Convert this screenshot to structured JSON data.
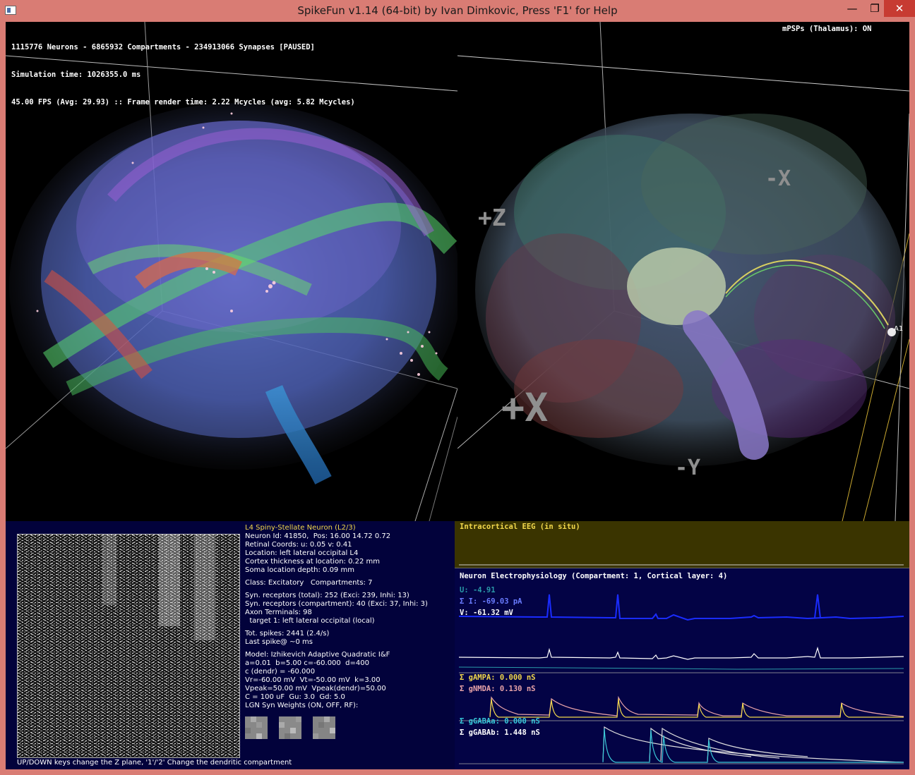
{
  "window": {
    "title": "SpikeFun v1.14 (64-bit) by Ivan Dimkovic, Press 'F1' for Help",
    "min_glyph": "—",
    "max_glyph": "❐",
    "close_glyph": "✕"
  },
  "hud": {
    "line1": "1115776 Neurons - 6865932 Compartments - 234913066 Synapses [PAUSED]",
    "line2": "Simulation time: 1026355.0 ms",
    "line3": "45.00 FPS (Avg: 29.93) :: Frame render time: 2.22 Mcycles (avg: 5.82 Mcycles)",
    "mpsps": "mPSPs (Thalamus): ON"
  },
  "axes": {
    "plus_z": "+Z",
    "minus_x": "-X",
    "plus_x": "+X",
    "minus_y": "-Y",
    "marker": "A1"
  },
  "neuron_info": {
    "title": "L4 Spiny-Stellate Neuron (L2/3)",
    "lines": [
      "Neuron Id: 41850,  Pos: 16.00 14.72 0.72",
      "Retinal Coords: u: 0.05 v: 0.41",
      "Location: left lateral occipital L4",
      "Cortex thickness at location: 0.22 mm",
      "Soma location depth: 0.09 mm",
      "",
      "Class: Excitatory   Compartments: 7",
      "",
      "Syn. receptors (total): 252 (Exci: 239, Inhi: 13)",
      "Syn. receptors (compartment): 40 (Exci: 37, Inhi: 3)",
      "Axon Terminals: 98",
      "  target 1: left lateral occipital (local)",
      "",
      "Tot. spikes: 2441 (2.4/s)",
      "Last spike@ ~0 ms",
      "",
      "Model: Izhikevich Adaptive Quadratic I&F",
      "a=0.01  b=5.00 c=-60.000  d=400",
      "c (dendr) = -60.000",
      "Vr=-60.00 mV  Vt=-50.00 mV  k=3.00",
      "Vpeak=50.00 mV  Vpeak(dendr)=50.00",
      "C = 100 uF  Gu: 3.0  Gd: 5.0",
      "LGN Syn Weights (ON, OFF, RF):"
    ],
    "footer": "UP/DOWN keys change the Z plane, '1'/'2' Change the dendritic compartment"
  },
  "eeg": {
    "title": "Intracortical EEG (in situ)"
  },
  "ephys": {
    "title": "Neuron Electrophysiology (Compartment: 1, Cortical layer: 4)",
    "u_label": "U: -4.91",
    "i_label": "Σ I: -69.03 pA",
    "v_label": "V: -61.32 mV",
    "gampa": "Σ gAMPA: 0.000 nS",
    "gnmda": "Σ gNMDA: 0.130 nS",
    "ggabaa": "Σ gGABAa: 0.000 nS",
    "ggabab": "Σ gGABAb: 1.448 nS"
  },
  "colors": {
    "u_label": "#2a9aa8",
    "i_label": "#6a7cff",
    "v_label": "#ffffff",
    "gampa": "#f2d84c",
    "gnmda": "#e8a3a8",
    "ggabaa": "#38c8d8",
    "ggabab": "#ffffff"
  }
}
